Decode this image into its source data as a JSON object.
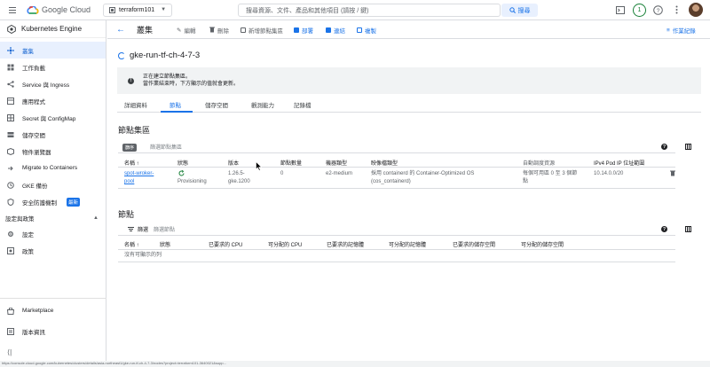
{
  "topbar": {
    "brand": "Google Cloud",
    "project": "terraform101",
    "search_placeholder": "搜尋資源、文件、產品和其他項目 (請按 / 鍵)",
    "search_button": "搜尋",
    "notification_count": "1"
  },
  "sidebar": {
    "title": "Kubernetes Engine",
    "items": [
      {
        "label": "叢集",
        "icon": "clusters-icon",
        "active": true
      },
      {
        "label": "工作負載",
        "icon": "workloads-icon"
      },
      {
        "label": "Service 與 Ingress",
        "icon": "services-icon"
      },
      {
        "label": "應用程式",
        "icon": "applications-icon"
      },
      {
        "label": "Secret 與 ConfigMap",
        "icon": "secret-icon"
      },
      {
        "label": "儲存空間",
        "icon": "storage-icon"
      },
      {
        "label": "物件瀏覽器",
        "icon": "object-browser-icon"
      },
      {
        "label": "Migrate to Containers",
        "icon": "migrate-icon"
      },
      {
        "label": "GKE 備份",
        "icon": "backup-icon"
      },
      {
        "label": "安全防護機制",
        "icon": "security-icon",
        "badge": "最新"
      }
    ],
    "section_label": "設定與政策",
    "section_items": [
      {
        "label": "設定",
        "icon": "settings-icon"
      },
      {
        "label": "政策",
        "icon": "policy-icon"
      }
    ],
    "marketplace": "Marketplace",
    "release_notes": "版本資訊"
  },
  "actionbar": {
    "title": "叢集",
    "edit": "編輯",
    "delete": "刪除",
    "add_pool": "新增節點集區",
    "deploy": "部署",
    "connect": "連結",
    "duplicate": "複製",
    "operations": "作業紀錄"
  },
  "cluster": {
    "name": "gke-run-tf-ch-4-7-3",
    "banner_line1": "正在建立節點集區。",
    "banner_line2": "當作業結束時，下方顯示的值就會更新。"
  },
  "tabs": [
    "詳細資料",
    "節點",
    "儲存空間",
    "觀測能力",
    "記錄檔"
  ],
  "node_pools": {
    "heading": "節點集區",
    "filter_label": "篩選",
    "filter_placeholder": "篩選節點集區",
    "tooltip": "篩序",
    "columns": [
      "名稱 ↑",
      "狀態",
      "版本",
      "節點數量",
      "機器類型",
      "映像檔類型",
      "自動調度資源",
      "IPv4 Pod IP 位址範圍"
    ],
    "row": {
      "name_line1": "spot-wroker-",
      "name_line2": "pool",
      "status": "Provisioning",
      "version_line1": "1.26.5-",
      "version_line2": "gke.1200",
      "count": "0",
      "machine": "e2-medium",
      "image_line1": "採用 containerd 的 Container-Optimized OS",
      "image_line2": "(cos_containerd)",
      "autoscale_line1": "每個可用區 0 至 3 個節",
      "autoscale_line2": "點",
      "ip_range": "10.14.0.0/20"
    }
  },
  "nodes": {
    "heading": "節點",
    "filter_label": "篩選",
    "filter_placeholder": "篩選節點",
    "columns": [
      "名稱 ↑",
      "狀態",
      "已要求的 CPU",
      "可分配的 CPU",
      "已要求的記憶體",
      "可分配的記憶體",
      "已要求的儲存空間",
      "可分配的儲存空間"
    ],
    "empty": "沒有可顯示的列"
  },
  "statusbar": "https://console.cloud.google.com/kubernetes/clusters/details/asia-northeast1/gke-run-tf-ch-4-7-3/nodes?project=terraform101-3640021&supp...",
  "colors": {
    "accent": "#1a73e8",
    "success": "#188038"
  }
}
